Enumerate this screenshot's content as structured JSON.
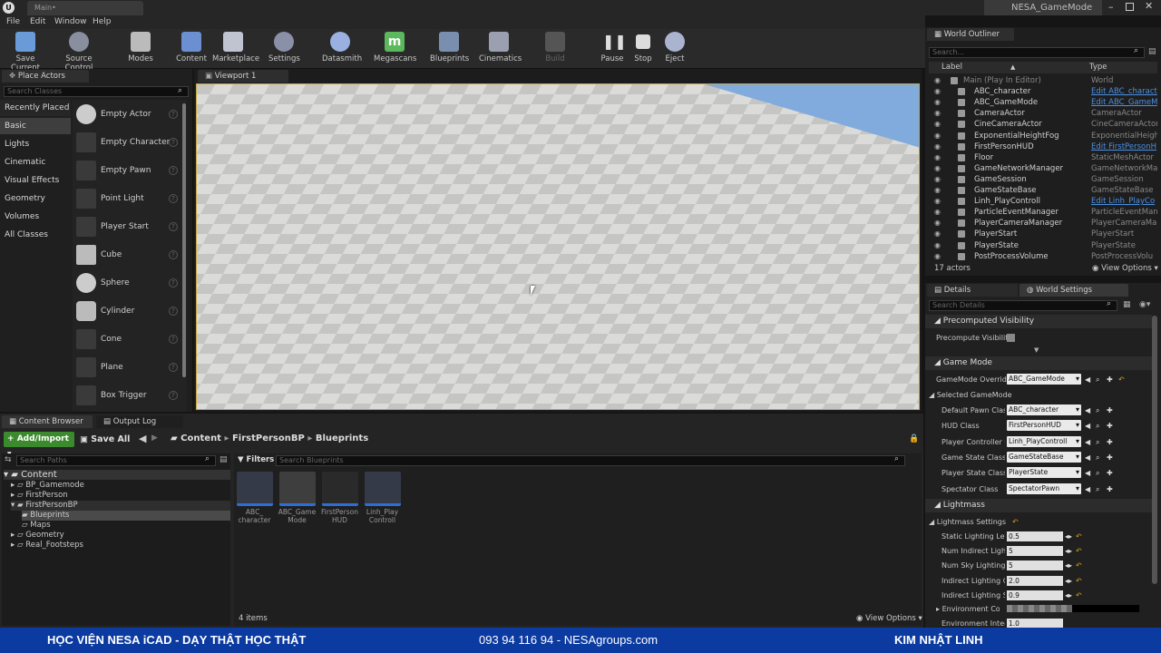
{
  "window": {
    "tab_title": "Main•",
    "game_mode_title": "NESA_GameMode"
  },
  "menu": [
    "File",
    "Edit",
    "Window",
    "Help"
  ],
  "toolbar": [
    {
      "label": "Save Current",
      "icon": "save-icon"
    },
    {
      "label": "Source Control",
      "icon": "source-control-icon"
    },
    {
      "label": "Modes",
      "icon": "modes-icon"
    },
    {
      "label": "Content",
      "icon": "content-icon"
    },
    {
      "label": "Marketplace",
      "icon": "marketplace-icon"
    },
    {
      "label": "Settings",
      "icon": "settings-icon"
    },
    {
      "label": "Datasmith",
      "icon": "datasmith-icon"
    },
    {
      "label": "Megascans",
      "icon": "megascans-icon"
    },
    {
      "label": "Blueprints",
      "icon": "blueprints-icon"
    },
    {
      "label": "Cinematics",
      "icon": "cinematics-icon"
    },
    {
      "label": "Build",
      "icon": "build-icon"
    },
    {
      "label": "Pause",
      "icon": "pause-icon"
    },
    {
      "label": "Stop",
      "icon": "stop-icon"
    },
    {
      "label": "Eject",
      "icon": "eject-icon"
    }
  ],
  "place_actors": {
    "tab": "Place Actors",
    "search_placeholder": "Search Classes",
    "categories": [
      "Recently Placed",
      "Basic",
      "Lights",
      "Cinematic",
      "Visual Effects",
      "Geometry",
      "Volumes",
      "All Classes"
    ],
    "actors": [
      "Empty Actor",
      "Empty Character",
      "Empty Pawn",
      "Point Light",
      "Player Start",
      "Cube",
      "Sphere",
      "Cylinder",
      "Cone",
      "Plane",
      "Box Trigger"
    ]
  },
  "viewport": {
    "tab": "Viewport 1"
  },
  "content_browser": {
    "tab": "Content Browser",
    "output_tab": "Output Log",
    "add_import": "Add/Import",
    "save_all": "Save All",
    "breadcrumb": [
      "Content",
      "FirstPersonBP",
      "Blueprints"
    ],
    "search_paths_placeholder": "Search Paths",
    "filters": "Filters",
    "search_placeholder": "Search Blueprints",
    "tree": [
      "Content",
      "BP_Gamemode",
      "FirstPerson",
      "FirstPersonBP",
      "Blueprints",
      "Maps",
      "Geometry",
      "Real_Footsteps"
    ],
    "assets": [
      {
        "name": "ABC_\ncharacter",
        "icon": "character-icon"
      },
      {
        "name": "ABC_Game\nMode",
        "icon": "gamepad-icon"
      },
      {
        "name": "FirstPerson\nHUD",
        "icon": "hud-icon"
      },
      {
        "name": "Linh_Play\nControll",
        "icon": "controller-icon"
      }
    ],
    "item_count": "4 items",
    "view_options": "View Options"
  },
  "outliner": {
    "tab": "World Outliner",
    "search_placeholder": "Search...",
    "col_label": "Label",
    "col_type": "Type",
    "rows": [
      {
        "label": "Main (Play In Editor)",
        "type": "World",
        "link": false
      },
      {
        "label": "ABC_character",
        "type": "Edit ABC_charact",
        "link": true
      },
      {
        "label": "ABC_GameMode",
        "type": "Edit ABC_GameM",
        "link": true
      },
      {
        "label": "CameraActor",
        "type": "CameraActor",
        "link": false
      },
      {
        "label": "CineCameraActor",
        "type": "CineCameraActor",
        "link": false
      },
      {
        "label": "ExponentialHeightFog",
        "type": "ExponentialHeight",
        "link": false
      },
      {
        "label": "FirstPersonHUD",
        "type": "Edit FirstPersonH",
        "link": true
      },
      {
        "label": "Floor",
        "type": "StaticMeshActor",
        "link": false
      },
      {
        "label": "GameNetworkManager",
        "type": "GameNetworkMan",
        "link": false
      },
      {
        "label": "GameSession",
        "type": "GameSession",
        "link": false
      },
      {
        "label": "GameStateBase",
        "type": "GameStateBase",
        "link": false
      },
      {
        "label": "Linh_PlayControll",
        "type": "Edit Linh_PlayCo",
        "link": true
      },
      {
        "label": "ParticleEventManager",
        "type": "ParticleEventMan",
        "link": false
      },
      {
        "label": "PlayerCameraManager",
        "type": "PlayerCameraMa",
        "link": false
      },
      {
        "label": "PlayerStart",
        "type": "PlayerStart",
        "link": false
      },
      {
        "label": "PlayerState",
        "type": "PlayerState",
        "link": false
      },
      {
        "label": "PostProcessVolume",
        "type": "PostProcessVolu",
        "link": false
      }
    ],
    "count": "17 actors",
    "view_options": "View Options"
  },
  "details": {
    "tab_details": "Details",
    "tab_world": "World Settings",
    "search_placeholder": "Search Details",
    "precomputed_header": "Precomputed Visibility",
    "precompute_label": "Precompute Visibility",
    "gamemode_header": "Game Mode",
    "gamemode_override_label": "GameMode Override",
    "gamemode_override_value": "ABC_GameMode",
    "selected_gamemode": "Selected GameMode",
    "gm_rows": [
      {
        "label": "Default Pawn Class",
        "value": "ABC_character"
      },
      {
        "label": "HUD Class",
        "value": "FirstPersonHUD"
      },
      {
        "label": "Player Controller Cla",
        "value": "Linh_PlayControll"
      },
      {
        "label": "Game State Class",
        "value": "GameStateBase"
      },
      {
        "label": "Player State Class",
        "value": "PlayerState"
      },
      {
        "label": "Spectator Class",
        "value": "SpectatorPawn"
      }
    ],
    "lightmass_header": "Lightmass",
    "lightmass_settings": "Lightmass Settings",
    "lm_rows": [
      {
        "label": "Static Lighting Level",
        "value": "0.5"
      },
      {
        "label": "Num Indirect Lightin",
        "value": "5"
      },
      {
        "label": "Num Sky Lighting Bo",
        "value": "5"
      },
      {
        "label": "Indirect Lighting Qua",
        "value": "2.0"
      },
      {
        "label": "Indirect Lighting Smo",
        "value": "0.9"
      }
    ],
    "env_color_label": "Environment Color",
    "env_intensity_label": "Environment Intensit",
    "env_intensity_value": "1.0"
  },
  "banner": {
    "left": "HỌC VIỆN NESA iCAD - DẠY THẬT HỌC THẬT",
    "center": "093 94 116 94 - NESAgroups.com",
    "right": "KIM NHẬT LINH"
  }
}
